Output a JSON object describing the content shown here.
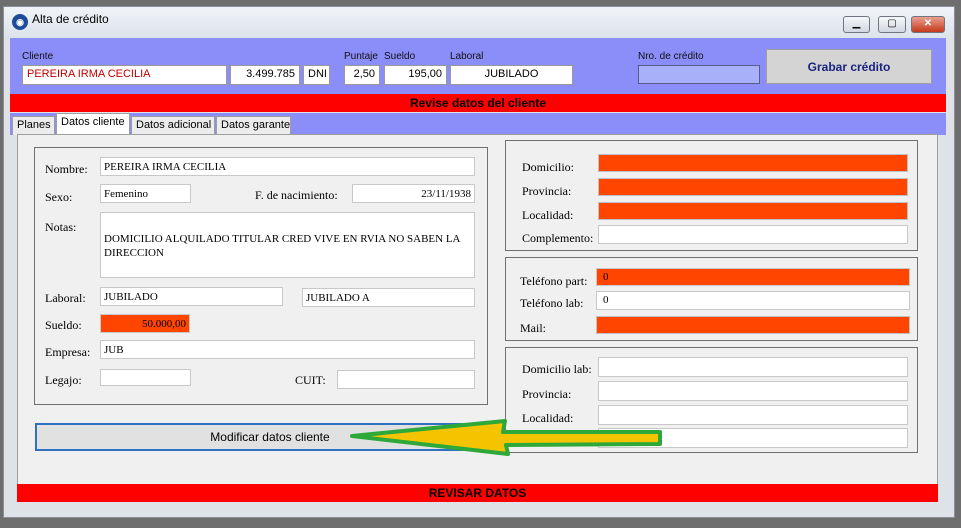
{
  "window": {
    "title": "Alta de crédito",
    "min_label": "▁",
    "max_label": "▢",
    "close_label": "✕"
  },
  "header": {
    "cliente_label": "Cliente",
    "cliente_value": "PEREIRA IRMA CECILIA",
    "doc_number": "3.499.785",
    "doc_type": "DNI",
    "puntaje_label": "Puntaje",
    "puntaje_value": "2,50",
    "sueldo_label": "Sueldo",
    "sueldo_value": "195,00",
    "laboral_label": "Laboral",
    "laboral_value": "JUBILADO",
    "nro_credito_label": "Nro. de crédito",
    "nro_credito_value": "",
    "save_button": "Grabar crédito"
  },
  "alert_top": "Revise datos del cliente",
  "tabs": [
    {
      "label": "Planes"
    },
    {
      "label": "Datos cliente"
    },
    {
      "label": "Datos adicional"
    },
    {
      "label": "Datos garante"
    }
  ],
  "cliente": {
    "nombre_label": "Nombre:",
    "nombre_value": "PEREIRA IRMA CECILIA",
    "sexo_label": "Sexo:",
    "sexo_value": "Femenino",
    "fnac_label": "F. de nacimiento:",
    "fnac_value": "23/11/1938",
    "notas_label": "Notas:",
    "notas_value": "DOMICILIO ALQUILADO TITULAR CRED VIVE EN RVIA NO SABEN LA DIRECCION",
    "laboral_label": "Laboral:",
    "laboral_value": "JUBILADO",
    "laboral_value2": "JUBILADO A",
    "sueldo_label": "Sueldo:",
    "sueldo_value": "50.000,00",
    "empresa_label": "Empresa:",
    "empresa_value": "JUB",
    "legajo_label": "Legajo:",
    "legajo_value": "",
    "cuit_label": "CUIT:",
    "cuit_value": ""
  },
  "domicilio": {
    "domicilio_label": "Domicilio:",
    "provincia_label": "Provincia:",
    "localidad_label": "Localidad:",
    "complemento_label": "Complemento:"
  },
  "contacto": {
    "tel_part_label": "Teléfono part:",
    "tel_part_value": "0",
    "tel_lab_label": "Teléfono lab:",
    "tel_lab_value": "0",
    "mail_label": "Mail:"
  },
  "laboral_dom": {
    "domicilio_label": "Domicilio lab:",
    "provincia_label": "Provincia:",
    "localidad_label": "Localidad:"
  },
  "modify_button": "Modificar datos cliente",
  "alert_bottom": "REVISAR DATOS",
  "colors": {
    "header_bg": "#8b8ef9",
    "alert_red": "#ff0000",
    "missing_orange": "#ff4500",
    "arrow_fill": "#f5c400",
    "arrow_stroke": "#2fa83a"
  }
}
